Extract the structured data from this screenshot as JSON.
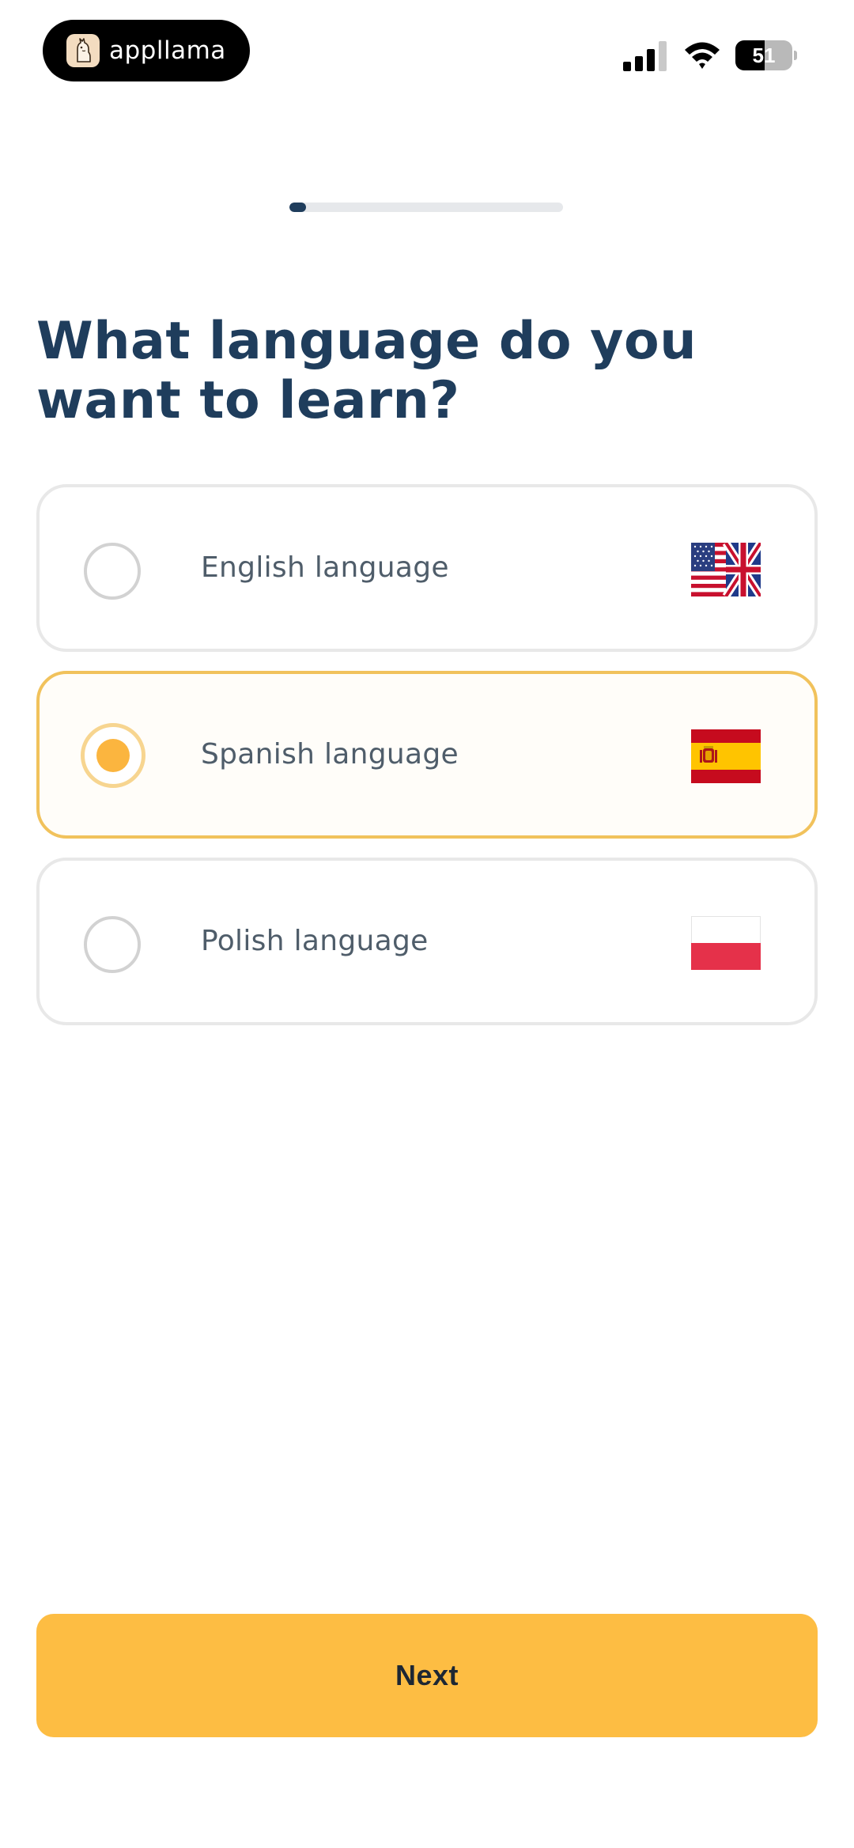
{
  "status_bar": {
    "app_name": "appllama",
    "battery_level": "51",
    "battery_fraction": 0.51
  },
  "progress": {
    "fraction": 0.06
  },
  "title": "What language do you want to learn?",
  "options": [
    {
      "label": "English language",
      "selected": false,
      "flag_icon": "us-uk-flag-icon"
    },
    {
      "label": "Spanish language",
      "selected": true,
      "flag_icon": "spain-flag-icon"
    },
    {
      "label": "Polish language",
      "selected": false,
      "flag_icon": "poland-flag-icon"
    }
  ],
  "next_button": {
    "label": "Next"
  },
  "colors": {
    "primary_text": "#1f3d5c",
    "accent": "#fdbd43",
    "selected_border": "#f1c25c"
  }
}
